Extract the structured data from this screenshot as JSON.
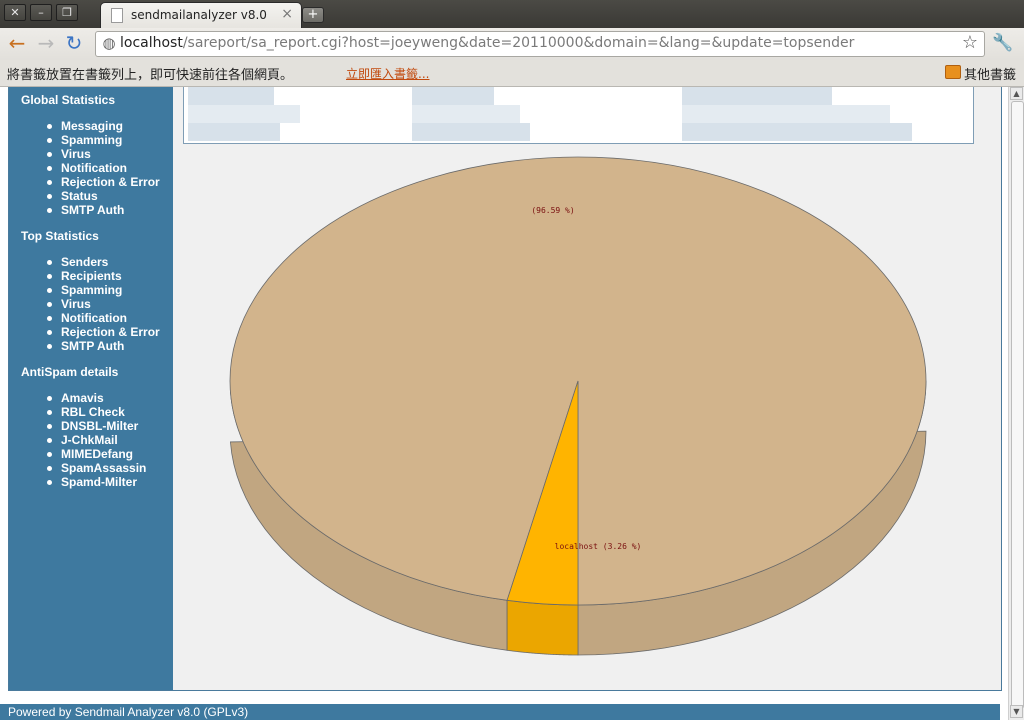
{
  "window": {
    "controls": [
      "close-icon",
      "minimize-icon",
      "restore-icon"
    ],
    "tab_title": "sendmailanalyzer v8.0",
    "new_tab_icon": "plus-icon"
  },
  "toolbar": {
    "url_host": "localhost",
    "url_path": "/sareport/sa_report.cgi?host=joeyweng&date=20110000&domain=&lang=&update=topsender"
  },
  "bookmarks": {
    "message": "將書籤放置在書籤列上，即可快速前往各個網頁。",
    "import_link": "立即匯入書籤...",
    "other_folder": "其他書籤"
  },
  "sidebar": {
    "sections": [
      {
        "title": "Global Statistics",
        "items": [
          "Messaging",
          "Spamming",
          "Virus",
          "Notification",
          "Rejection & Error",
          "Status",
          "SMTP Auth"
        ]
      },
      {
        "title": "Top Statistics",
        "items": [
          "Senders",
          "Recipients",
          "Spamming",
          "Virus",
          "Notification",
          "Rejection & Error",
          "SMTP Auth"
        ]
      },
      {
        "title": "AntiSpam details",
        "items": [
          "Amavis",
          "RBL Check",
          "DNSBL-Milter",
          "J-ChkMail",
          "MIMEDefang",
          "SpamAssassin",
          "Spamd-Milter"
        ]
      }
    ]
  },
  "chart_data": {
    "type": "pie",
    "style": "3d",
    "slices": [
      {
        "label": "",
        "value": 96.59,
        "display": "(96.59 %)",
        "color": "#d2b48c"
      },
      {
        "label": "localhost",
        "value": 3.26,
        "display": "localhost (3.26 %)",
        "color": "#ffb400"
      }
    ]
  },
  "footer": {
    "text": "Powered by Sendmail Analyzer v8.0 (GPLv3)"
  }
}
